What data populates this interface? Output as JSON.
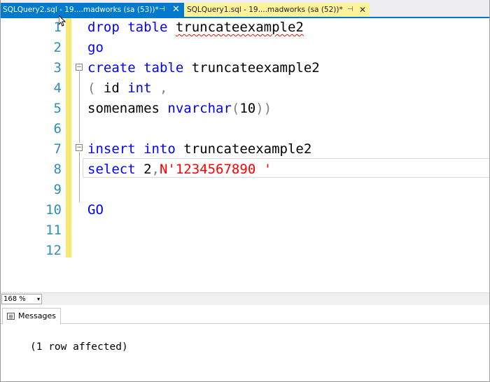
{
  "tabs": [
    {
      "label": "SQLQuery2.sql - 19....madworks (sa (53))*",
      "pin": "⊣",
      "close": "✕",
      "state": "inactive"
    },
    {
      "label": "SQLQuery1.sql - 19....madworks (sa (52))*",
      "pin": "⊣",
      "close": "✕",
      "state": "active"
    }
  ],
  "editor": {
    "line_numbers": [
      "1",
      "2",
      "3",
      "4",
      "5",
      "6",
      "7",
      "8",
      "9",
      "10",
      "11",
      "12"
    ],
    "lines": [
      [
        {
          "t": "drop table ",
          "c": "kw"
        },
        {
          "t": "truncateexample2",
          "c": "squiggle"
        }
      ],
      [
        {
          "t": "go",
          "c": "kw"
        }
      ],
      [
        {
          "t": "create table ",
          "c": "kw"
        },
        {
          "t": "truncateexample2",
          "c": ""
        }
      ],
      [
        {
          "t": "( ",
          "c": "gray"
        },
        {
          "t": "id ",
          "c": ""
        },
        {
          "t": "int",
          "c": "kw"
        },
        {
          "t": " ,",
          "c": "gray"
        }
      ],
      [
        {
          "t": "somenames ",
          "c": ""
        },
        {
          "t": "nvarchar",
          "c": "kw"
        },
        {
          "t": "(",
          "c": "gray"
        },
        {
          "t": "10",
          "c": ""
        },
        {
          "t": "))",
          "c": "gray"
        }
      ],
      [],
      [
        {
          "t": "insert into ",
          "c": "kw"
        },
        {
          "t": "truncateexample2",
          "c": ""
        }
      ],
      [
        {
          "t": "select ",
          "c": "kw"
        },
        {
          "t": "2",
          "c": ""
        },
        {
          "t": ",",
          "c": "gray"
        },
        {
          "t": "N'1234567890 '",
          "c": "str"
        }
      ],
      [],
      [
        {
          "t": "GO",
          "c": "kw"
        }
      ],
      [],
      []
    ],
    "zoom": "168 %",
    "zoom_arrow": "▾"
  },
  "results": {
    "tab_label": "Messages",
    "message": "(1 row affected)"
  },
  "colors": {
    "accent": "#007acc",
    "active_tab": "#fff29d",
    "keyword": "#0000ff",
    "string": "#ff0000",
    "line_number": "#2b91af",
    "change_bar": "#f7e970"
  }
}
